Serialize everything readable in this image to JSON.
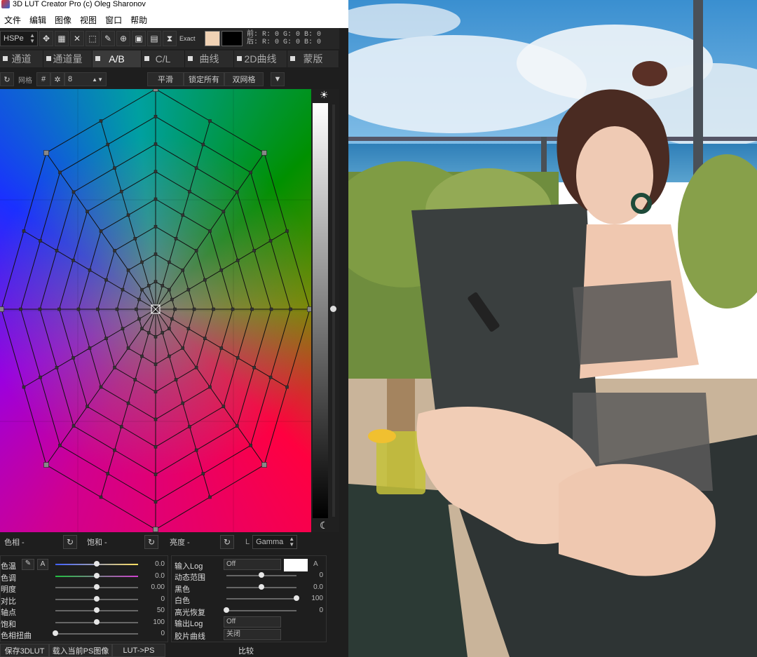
{
  "window": {
    "title": "3D LUT Creator Pro (c) Oleg Sharonov"
  },
  "menu": [
    "文件",
    "编辑",
    "图像",
    "视图",
    "窗口",
    "帮助"
  ],
  "toolbar": {
    "color_model": "HSPe",
    "exact_label": "Exact",
    "before_label": "前:",
    "after_label": "后:",
    "before_rgb": "R: 0  G: 0  B: 0",
    "after_rgb": "R: 0  G: 0  B: 0",
    "swatch_before": "#f0d2b4",
    "swatch_after": "#000000"
  },
  "tabs": [
    "通道",
    "通道量",
    "A/B",
    "C/L",
    "曲线",
    "2D曲线",
    "蒙版"
  ],
  "active_tab": "A/B",
  "gridbar": {
    "grid_label": "网格",
    "grid_size": "8",
    "smooth_button": "平滑",
    "lock_all_button": "锁定所有",
    "double_grid_button": "双网格"
  },
  "hsl_row": {
    "hue_label": "色相 -",
    "saturation_label": "饱和 -",
    "brightness_label": "亮度 -",
    "l_label": "L",
    "gamma_value": "Gamma"
  },
  "left_sliders": [
    {
      "label": "色温",
      "value": "0.0",
      "level": 0.5
    },
    {
      "label": "色调",
      "value": "0.0",
      "level": 0.5
    },
    {
      "label": "明度",
      "value": "0.00",
      "level": 0.5
    },
    {
      "label": "对比",
      "value": "0",
      "level": 0.5
    },
    {
      "label": "轴点",
      "value": "50",
      "level": 0.5
    },
    {
      "label": "饱和",
      "value": "100",
      "level": 0.5
    },
    {
      "label": "色相扭曲",
      "value": "0",
      "level": 0.0
    }
  ],
  "right_panel": {
    "input_log_label": "输入Log",
    "input_log_value": "Off",
    "dynamic_range_label": "动态范围",
    "dynamic_range_value": "0",
    "black_label": "黑色",
    "black_value": "0.0",
    "white_label": "白色",
    "white_value": "100",
    "highlight_label": "高光恢复",
    "highlight_value": "0",
    "output_log_label": "输出Log",
    "output_log_value": "Off",
    "film_curve_label": "胶片曲线",
    "film_curve_value": "关闭",
    "a_label": "A"
  },
  "bottom_bar": {
    "save_3dlut": "保存3DLUT",
    "load_ps_image": "载入当前PS图像",
    "lut_to_ps": "LUT->PS",
    "compare": "比较"
  }
}
